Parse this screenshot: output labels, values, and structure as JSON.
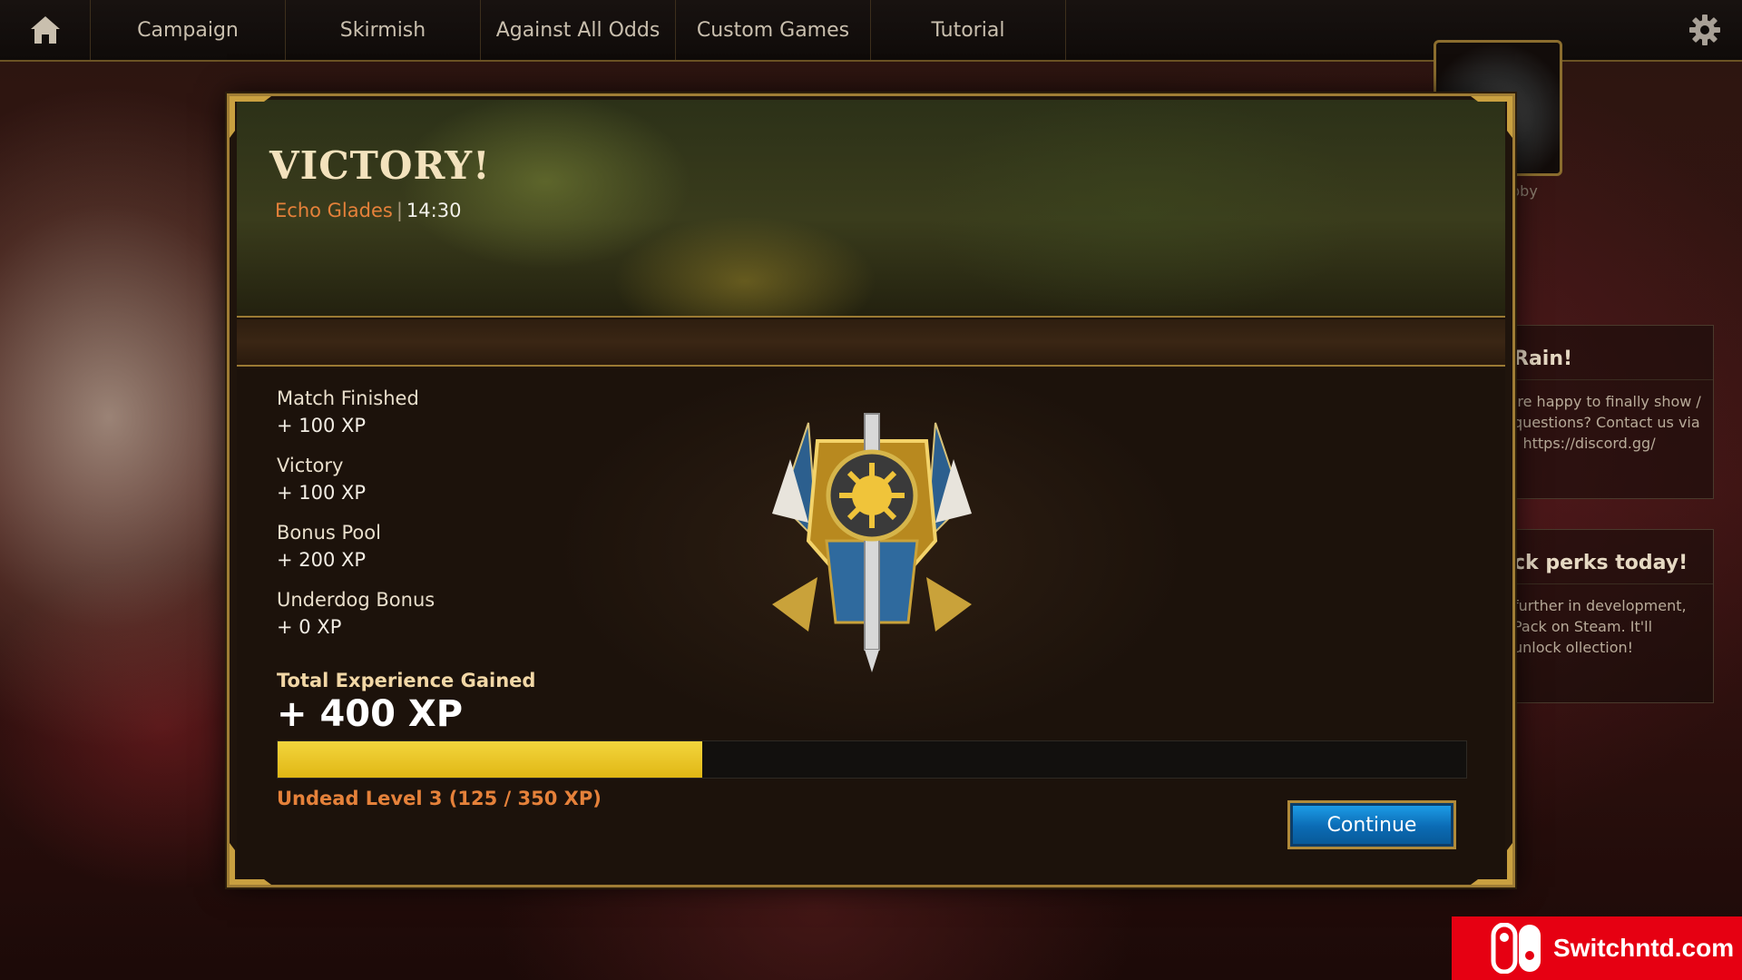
{
  "nav": {
    "tabs": [
      "Campaign",
      "Skirmish",
      "Against All Odds",
      "Custom Games",
      "Tutorial"
    ]
  },
  "background": {
    "lobby_label": "bby",
    "cards": [
      {
        "heading": "Rain!",
        "body": "'re happy to finally show / questions? Contact us via : https://discord.gg/"
      },
      {
        "heading": "ck perks today!",
        "body": "further in development, Pack on Steam. It'll unlock ollection!"
      }
    ]
  },
  "result": {
    "title": "VICTORY!",
    "map": "Echo Glades",
    "separator": "|",
    "duration": "14:30"
  },
  "xp": {
    "items": [
      {
        "label": "Match Finished",
        "value": "+ 100 XP"
      },
      {
        "label": "Victory",
        "value": "+ 100 XP"
      },
      {
        "label": "Bonus Pool",
        "value": "+ 200 XP"
      },
      {
        "label": "Underdog Bonus",
        "value": "+ 0 XP"
      }
    ],
    "total_label": "Total Experience Gained",
    "total_value": "+ 400 XP",
    "progress_fraction": 0.357,
    "level_text": "Undead Level 3 (125 / 350 XP)"
  },
  "actions": {
    "continue_label": "Continue"
  },
  "watermark": {
    "text": "Switchntd.com"
  },
  "colors": {
    "accent_orange": "#e5813a",
    "gold_border": "#a07d35",
    "progress_yellow": "#f3d53d",
    "button_blue": "#0b6bb4"
  },
  "icons": [
    "home-icon",
    "gear-icon",
    "faction-emblem-icon",
    "nintendo-switch-logo-icon"
  ]
}
